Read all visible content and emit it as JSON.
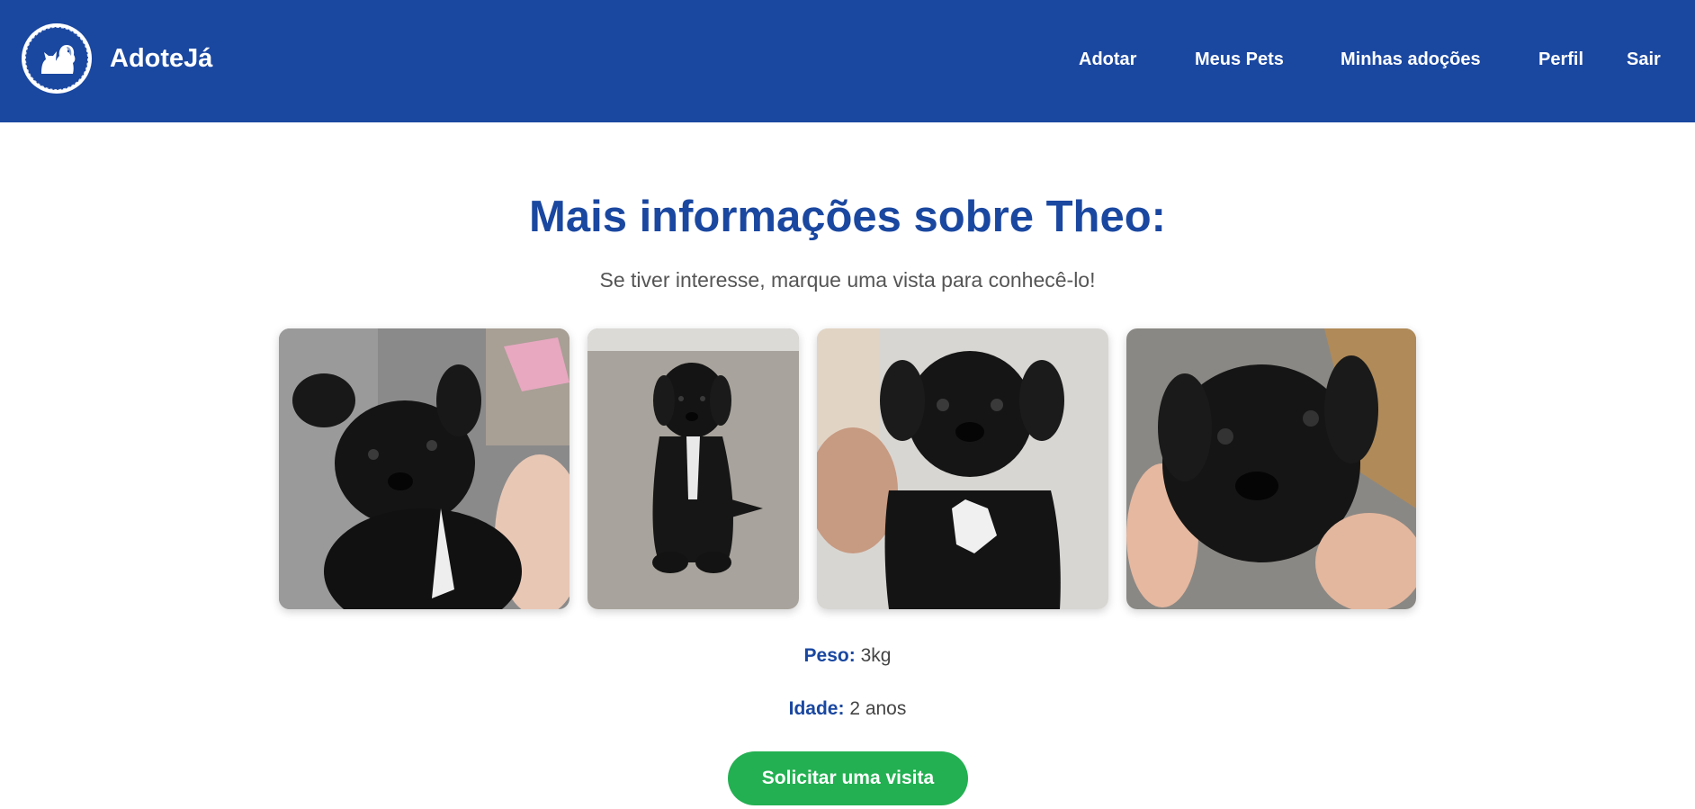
{
  "app": {
    "brand_name": "AdoteJá",
    "logo_icon": "dog-and-cat-icon",
    "brand_color": "#1a47a0"
  },
  "nav": {
    "items": [
      {
        "label": "Adotar"
      },
      {
        "label": "Meus Pets"
      },
      {
        "label": "Minhas adoções"
      },
      {
        "label": "Perfil"
      },
      {
        "label": "Sair"
      }
    ]
  },
  "main": {
    "title": "Mais informações sobre Theo:",
    "subtitle": "Se tiver interesse, marque uma vista para conhecê-lo!",
    "photos": [
      {
        "icon": "puppy-photo-1"
      },
      {
        "icon": "puppy-photo-2"
      },
      {
        "icon": "puppy-photo-3"
      },
      {
        "icon": "puppy-photo-4"
      }
    ],
    "weight_label": "Peso:",
    "weight_value": "3kg",
    "age_label": "Idade:",
    "age_value": "2 anos",
    "visit_button": "Solicitar uma visita",
    "button_color": "#23b052"
  }
}
